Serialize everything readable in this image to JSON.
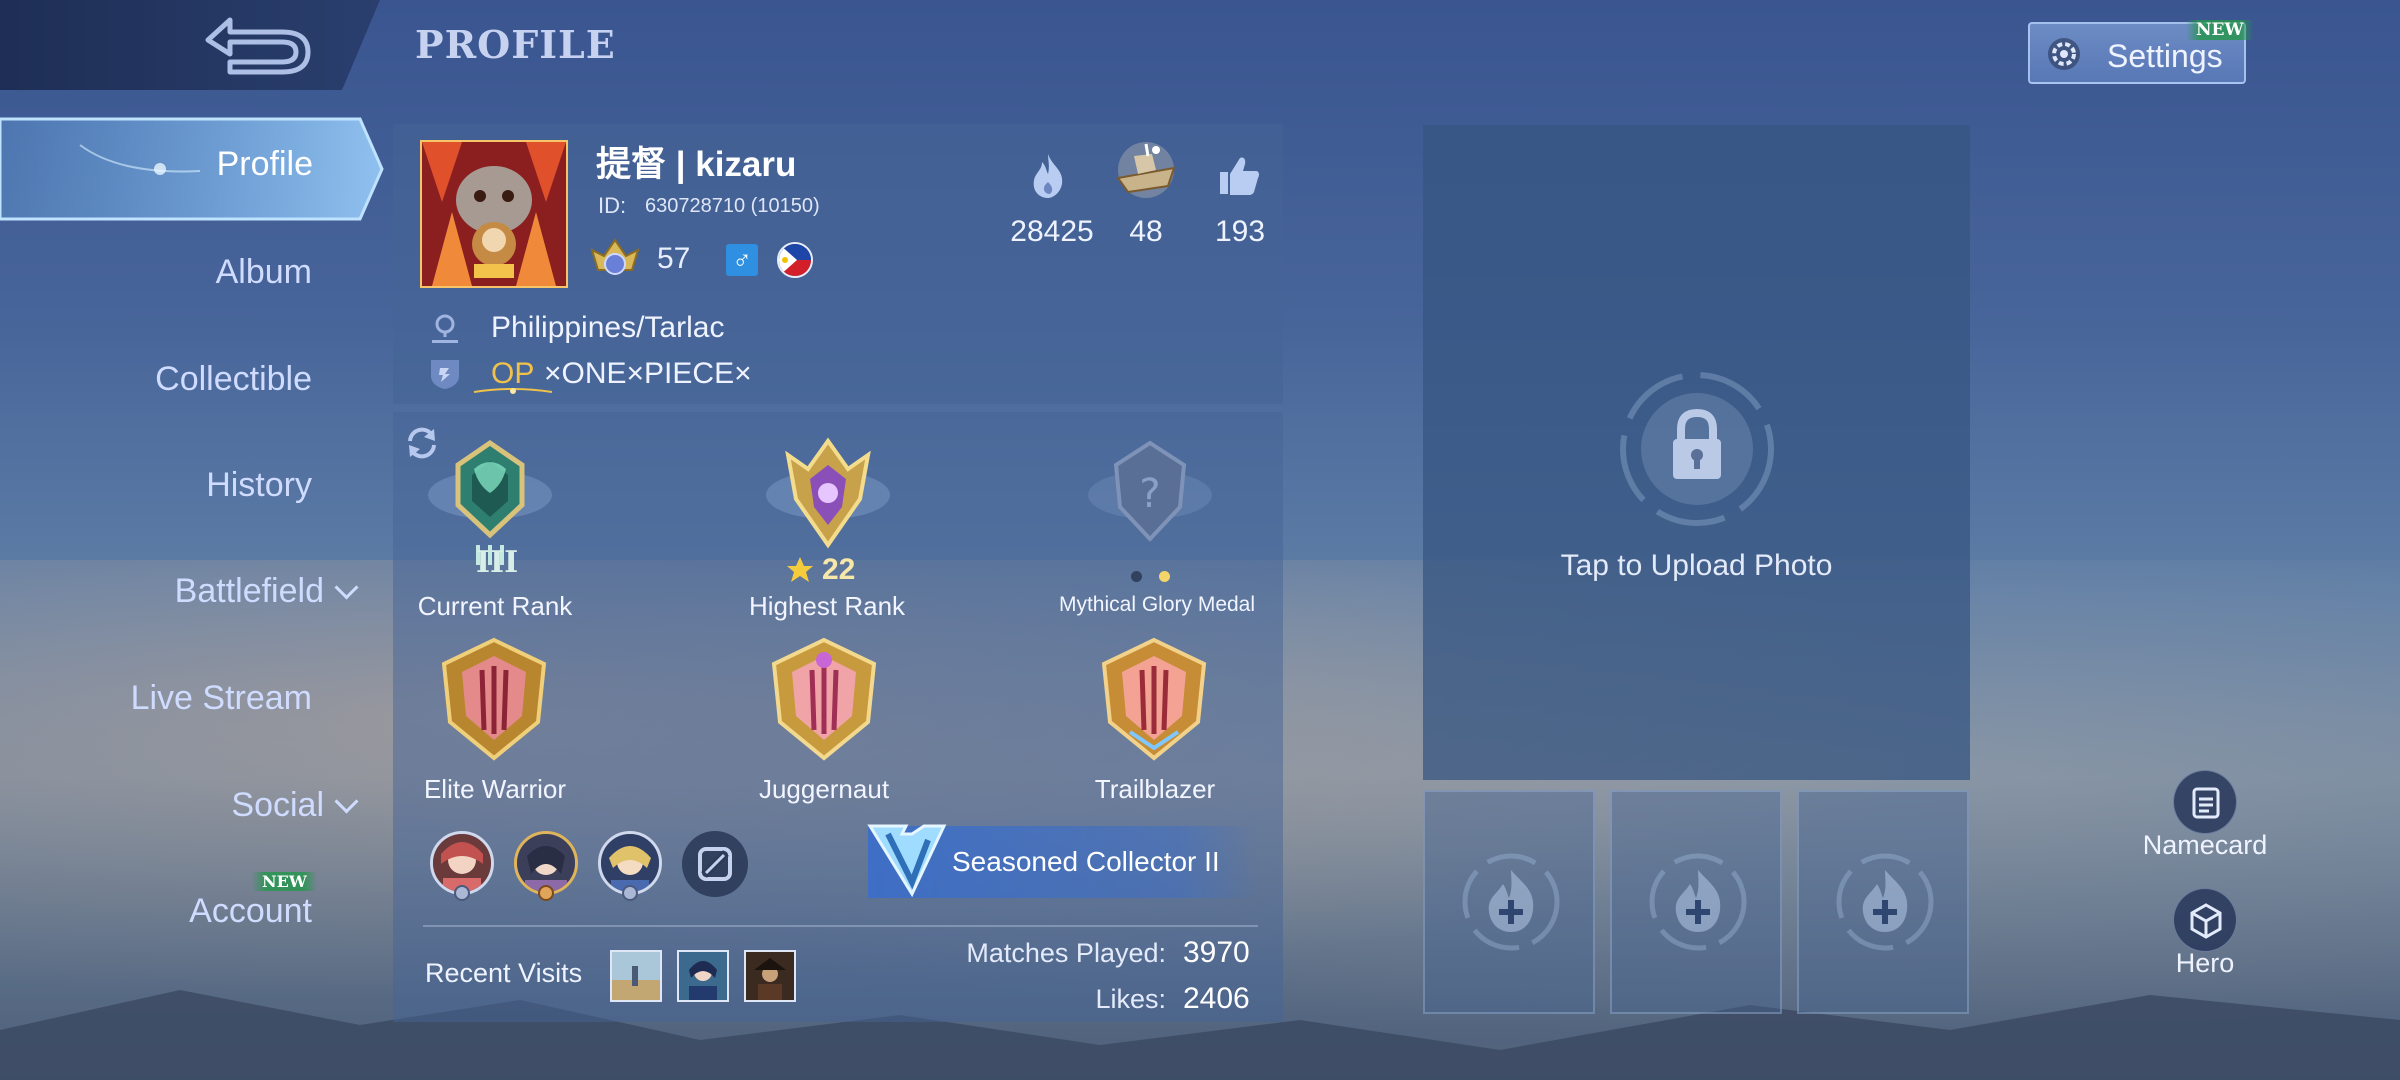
{
  "header": {
    "title": "PROFILE",
    "settings_label": "Settings",
    "settings_badge": "NEW"
  },
  "sidebar": {
    "items": [
      {
        "label": "Profile",
        "active": true
      },
      {
        "label": "Album"
      },
      {
        "label": "Collectible"
      },
      {
        "label": "History"
      },
      {
        "label": "Battlefield",
        "expandable": true
      },
      {
        "label": "Live Stream"
      },
      {
        "label": "Social",
        "expandable": true
      },
      {
        "label": "Account",
        "badge": "NEW"
      }
    ]
  },
  "profile": {
    "name": "提督 | kizaru",
    "id_label": "ID:",
    "id_value": "630728710 (10150)",
    "level": "57",
    "gender_symbol": "♂",
    "location": "Philippines/Tarlac",
    "squad_tag": "OP",
    "squad_name": "×ONE×PIECE×",
    "stats": {
      "popularity": "28425",
      "charm": "48",
      "likes": "193"
    }
  },
  "ranks": {
    "current": {
      "label": "Current Rank",
      "tier": "III"
    },
    "highest": {
      "label": "Highest Rank",
      "stars": "22"
    },
    "mythical": {
      "label": "Mythical Glory Medal"
    }
  },
  "medals": [
    {
      "label": "Elite Warrior"
    },
    {
      "label": "Juggernaut"
    },
    {
      "label": "Trailblazer"
    }
  ],
  "collector": {
    "label": "Seasoned Collector II"
  },
  "recent_visits_label": "Recent Visits",
  "summary": {
    "matches_label": "Matches Played:",
    "matches_value": "3970",
    "likes_label": "Likes:",
    "likes_value": "2406"
  },
  "photo": {
    "upload_label": "Tap to Upload Photo"
  },
  "right_buttons": {
    "namecard": "Namecard",
    "hero": "Hero"
  },
  "colors": {
    "accent_gold": "#f0c24a",
    "gender_blue": "#2f8fe0",
    "panel": "#46648f"
  }
}
